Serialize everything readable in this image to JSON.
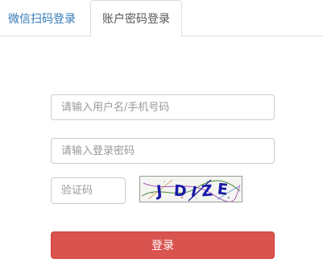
{
  "tabs": {
    "wechat_label": "微信扫码登录",
    "password_label": "账户密码登录",
    "active": "password"
  },
  "form": {
    "username_placeholder": "请输入用户名/手机号码",
    "password_placeholder": "请输入登录密码",
    "captcha_placeholder": "验证码",
    "captcha_text": "JDIZE",
    "login_label": "登录"
  },
  "colors": {
    "tab_link": "#337ab7",
    "tab_active_text": "#555555",
    "login_button": "#d9534f",
    "captcha_text": "#1a1aa8"
  }
}
